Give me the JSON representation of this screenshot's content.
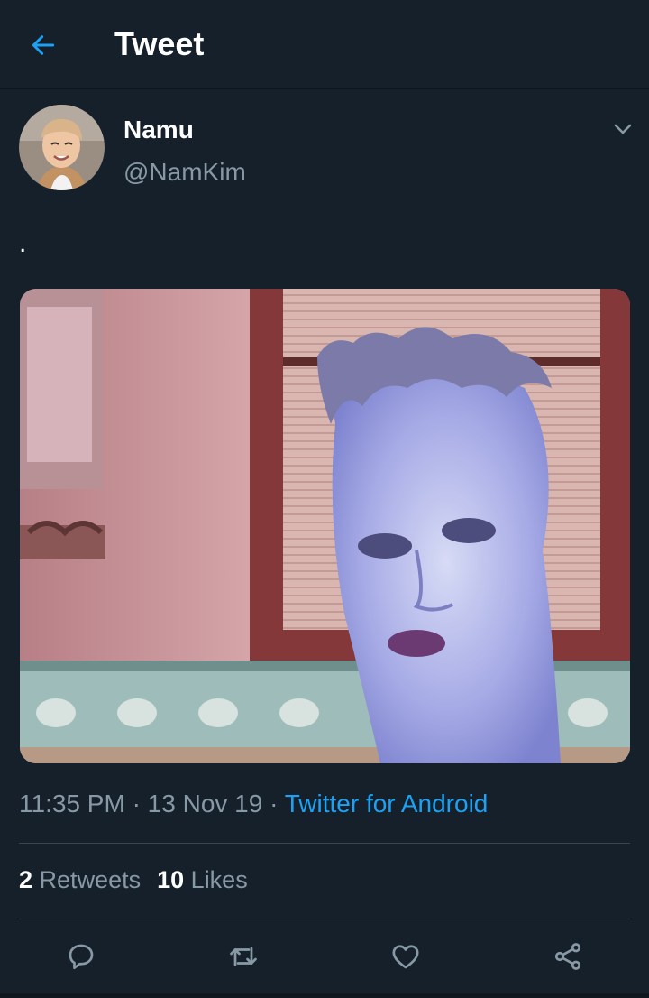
{
  "header": {
    "title": "Tweet",
    "back_icon": "arrow-left-icon",
    "accent": "#1da1f2"
  },
  "tweet": {
    "name": "Namu",
    "handle": "@NamKim",
    "text": ".",
    "time": "11:35 PM",
    "date": "13 Nov 19",
    "separator": "·",
    "source": "Twitter for Android",
    "retweets_count": "2",
    "retweets_label": "Retweets",
    "likes_count": "10",
    "likes_label": "Likes"
  },
  "actions": [
    "reply-icon",
    "retweet-icon",
    "like-icon",
    "share-icon"
  ],
  "colors": {
    "background": "#15202b",
    "secondary_text": "#8899a6",
    "divider": "#38444d",
    "link": "#1da1f2"
  }
}
